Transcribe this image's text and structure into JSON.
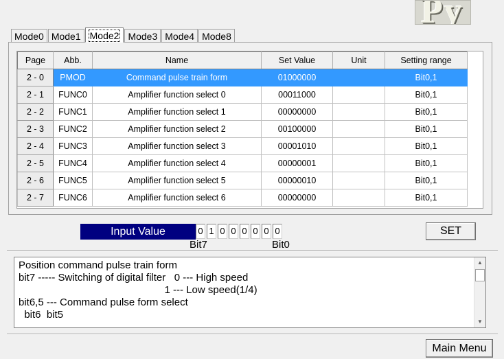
{
  "tabs": [
    "Mode0",
    "Mode1",
    "Mode2",
    "Mode3",
    "Mode4",
    "Mode8"
  ],
  "active_tab": "Mode2",
  "table": {
    "headers": [
      "Page",
      "Abb.",
      "Name",
      "Set Value",
      "Unit",
      "Setting range"
    ],
    "selected_page": "2 - 0",
    "rows": [
      {
        "page": "2 - 0",
        "abb": "PMOD",
        "name": "Command pulse train form",
        "value": "01000000",
        "unit": "",
        "range": "Bit0,1"
      },
      {
        "page": "2 - 1",
        "abb": "FUNC0",
        "name": "Amplifier function select 0",
        "value": "00011000",
        "unit": "",
        "range": "Bit0,1"
      },
      {
        "page": "2 - 2",
        "abb": "FUNC1",
        "name": "Amplifier function select 1",
        "value": "00000000",
        "unit": "",
        "range": "Bit0,1"
      },
      {
        "page": "2 - 3",
        "abb": "FUNC2",
        "name": "Amplifier function select 2",
        "value": "00100000",
        "unit": "",
        "range": "Bit0,1"
      },
      {
        "page": "2 - 4",
        "abb": "FUNC3",
        "name": "Amplifier function select 3",
        "value": "00001010",
        "unit": "",
        "range": "Bit0,1"
      },
      {
        "page": "2 - 5",
        "abb": "FUNC4",
        "name": "Amplifier function select 4",
        "value": "00000001",
        "unit": "",
        "range": "Bit0,1"
      },
      {
        "page": "2 - 6",
        "abb": "FUNC5",
        "name": "Amplifier function select 5",
        "value": "00000010",
        "unit": "",
        "range": "Bit0,1"
      },
      {
        "page": "2 - 7",
        "abb": "FUNC6",
        "name": "Amplifier function select 6",
        "value": "00000000",
        "unit": "",
        "range": "Bit0,1"
      }
    ]
  },
  "input": {
    "label": "Input Value",
    "bits": [
      "0",
      "1",
      "0",
      "0",
      "0",
      "0",
      "0",
      "0"
    ],
    "bit_high_label": "Bit7",
    "bit_low_label": "Bit0"
  },
  "set_button": "SET",
  "description": [
    "Position command pulse train form",
    "bit7 ----- Switching of digital filter   0 --- High speed",
    "                                                   1 --- Low speed(1/4)",
    "bit6,5 --- Command pulse form select",
    "  bit6  bit5"
  ],
  "main_menu_button": "Main Menu",
  "logo_text": "Py",
  "colors": {
    "selection": "#3399ff",
    "input_label_bg": "#000080"
  }
}
